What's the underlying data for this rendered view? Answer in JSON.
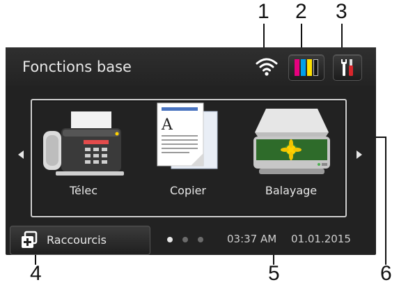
{
  "callouts": [
    "1",
    "2",
    "3",
    "4",
    "5",
    "6"
  ],
  "header": {
    "title": "Fonctions base"
  },
  "status": {
    "wifi_icon": "wifi-icon",
    "ink_icon": "ink-cartridge-icon",
    "settings_icon": "settings-tools-icon",
    "ink_colors": [
      "#e6007e",
      "#00a0e9",
      "#ffe100",
      "#111111"
    ]
  },
  "apps": [
    {
      "label": "Télec",
      "icon": "fax-icon"
    },
    {
      "label": "Copier",
      "icon": "copy-icon"
    },
    {
      "label": "Balayage",
      "icon": "scan-icon"
    }
  ],
  "footer": {
    "shortcuts_label": "Raccourcis",
    "shortcuts_icon": "shortcuts-icon",
    "time": "03:37 AM",
    "date": "01.01.2015",
    "page_dots": 3,
    "active_dot": 1
  }
}
